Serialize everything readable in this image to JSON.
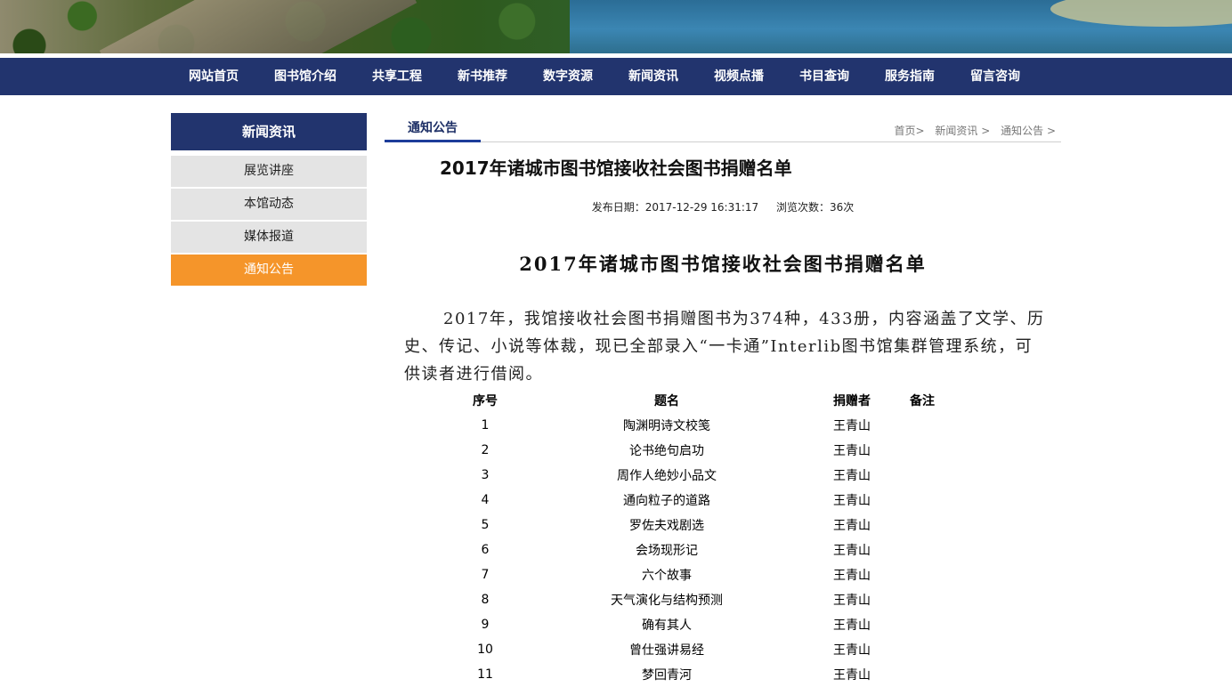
{
  "nav": {
    "items": [
      "网站首页",
      "图书馆介绍",
      "共享工程",
      "新书推荐",
      "数字资源",
      "新闻资讯",
      "视频点播",
      "书目查询",
      "服务指南",
      "留言咨询"
    ]
  },
  "sidebar": {
    "title": "新闻资讯",
    "items": [
      "展览讲座",
      "本馆动态",
      "媒体报道",
      "通知公告"
    ],
    "active": "通知公告"
  },
  "crumbbar": {
    "tab": "通知公告",
    "breadcrumb": [
      "首页>",
      "新闻资讯 >",
      "通知公告 >"
    ]
  },
  "article": {
    "title": "2017年诸城市图书馆接收社会图书捐赠名单",
    "publish_date": "发布日期：2017-12-29 16:31:17",
    "views": "浏览次数：36次",
    "doc_title": "2017年诸城市图书馆接收社会图书捐赠名单",
    "paragraph": "2017年，我馆接收社会图书捐赠图书为374种，433册，内容涵盖了文学、历史、传记、小说等体裁，现已全部录入“一卡通”Interlib图书馆集群管理系统，可供读者进行借阅。"
  },
  "table": {
    "headers": [
      "序号",
      "题名",
      "捐赠者",
      "备注"
    ],
    "rows": [
      [
        "1",
        "陶渊明诗文校笺",
        "王青山",
        ""
      ],
      [
        "2",
        "论书绝句启功",
        "王青山",
        ""
      ],
      [
        "3",
        "周作人绝妙小品文",
        "王青山",
        ""
      ],
      [
        "4",
        "通向粒子的道路",
        "王青山",
        ""
      ],
      [
        "5",
        "罗佐夫戏剧选",
        "王青山",
        ""
      ],
      [
        "6",
        "会场现形记",
        "王青山",
        ""
      ],
      [
        "7",
        "六个故事",
        "王青山",
        ""
      ],
      [
        "8",
        "天气演化与结构预测",
        "王青山",
        ""
      ],
      [
        "9",
        "确有其人",
        "王青山",
        ""
      ],
      [
        "10",
        "曾仕强讲易经",
        "王青山",
        ""
      ],
      [
        "11",
        "梦回青河",
        "王青山",
        ""
      ]
    ]
  },
  "colors": {
    "nav_bg": "#22346e",
    "active_item": "#f5952a",
    "sidebar_item_bg": "#e4e4e4"
  }
}
